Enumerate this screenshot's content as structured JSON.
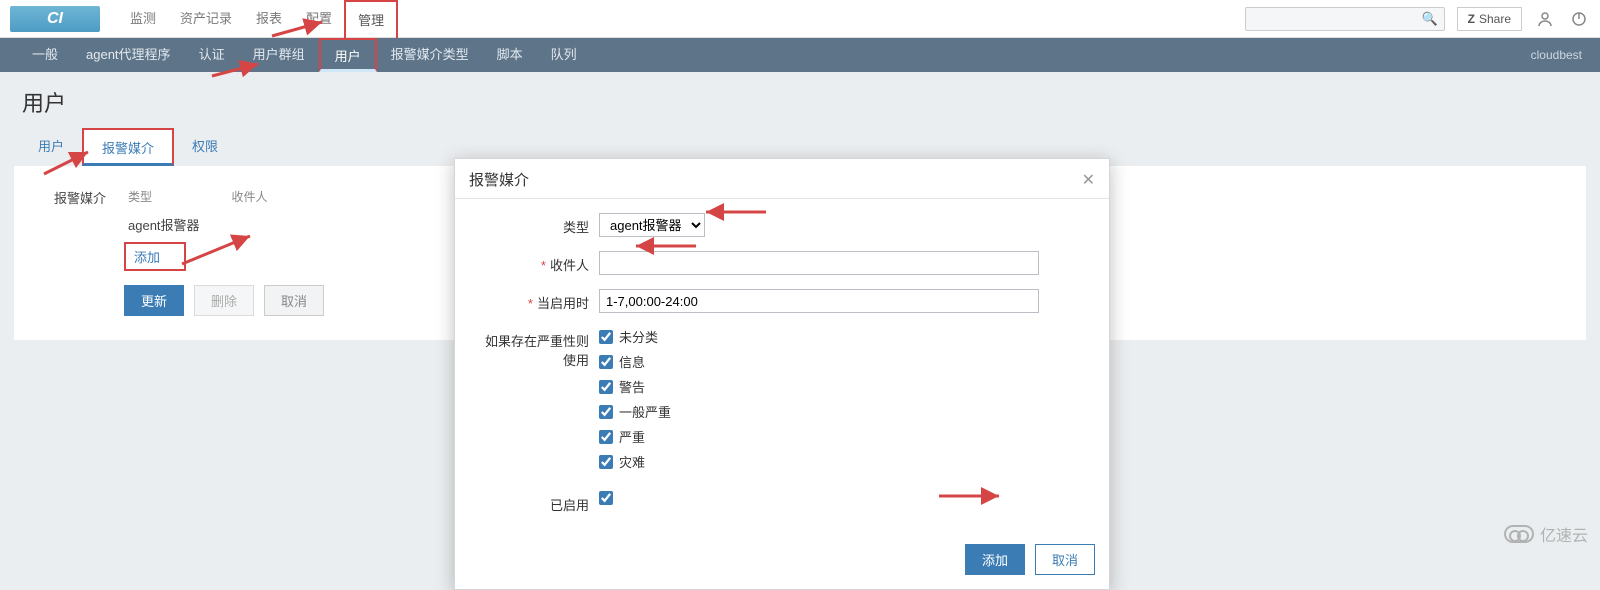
{
  "logo_text": "CI",
  "topnav": {
    "items": [
      "监测",
      "资产记录",
      "报表",
      "配置",
      "管理"
    ],
    "active_index": 4,
    "share_label": "Share"
  },
  "subnav": {
    "items": [
      "一般",
      "agent代理程序",
      "认证",
      "用户群组",
      "用户",
      "报警媒介类型",
      "脚本",
      "队列"
    ],
    "active_index": 4,
    "right_text": "cloudbest"
  },
  "page_title": "用户",
  "tabs": {
    "items": [
      "用户",
      "报警媒介",
      "权限"
    ],
    "active_index": 1
  },
  "media": {
    "section_label": "报警媒介",
    "headers": [
      "类型",
      "收件人"
    ],
    "rows": [
      {
        "type": "agent报警器",
        "recipient": ""
      }
    ],
    "add_label": "添加",
    "buttons": {
      "update": "更新",
      "delete": "删除",
      "cancel": "取消"
    }
  },
  "modal": {
    "title": "报警媒介",
    "fields": {
      "type_label": "类型",
      "type_value": "agent报警器",
      "recipient_label": "收件人",
      "recipient_value": "",
      "schedule_label": "当启用时",
      "schedule_value": "1-7,00:00-24:00",
      "severity_label": "如果存在严重性则使用",
      "severities": [
        "未分类",
        "信息",
        "警告",
        "一般严重",
        "严重",
        "灾难"
      ],
      "enabled_label": "已启用"
    },
    "buttons": {
      "add": "添加",
      "cancel": "取消"
    }
  },
  "watermark": "亿速云"
}
